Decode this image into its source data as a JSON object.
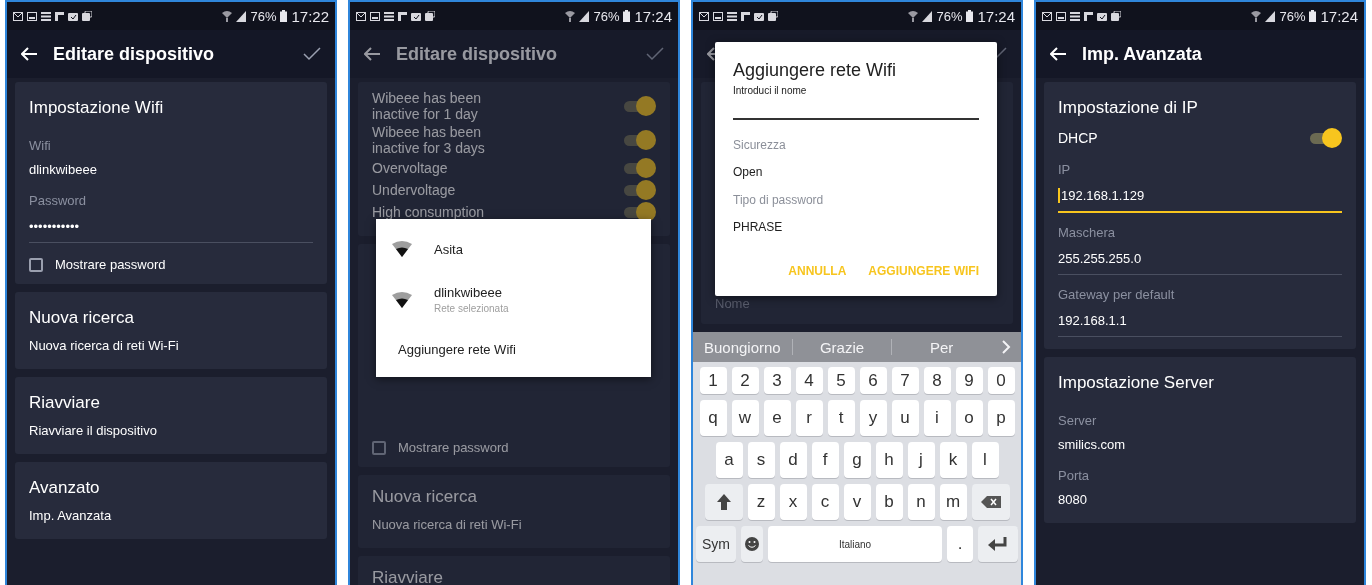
{
  "screens": [
    {
      "status_bar": {
        "battery": "76%",
        "time": "17:22"
      },
      "app_bar": {
        "title": "Editare dispositivo",
        "confirm": true
      },
      "cards": [
        {
          "title": "Impostazione Wifi",
          "rows": [
            {
              "kind": "field",
              "label": "Wifi",
              "value": "dlinkwibeee"
            },
            {
              "kind": "input",
              "label": "Password",
              "value": "•••••••••••",
              "focused": false
            },
            {
              "kind": "checkbox",
              "label": "Mostrare password",
              "checked": false
            }
          ]
        },
        {
          "title": "Nuova ricerca",
          "rows": [
            {
              "kind": "text",
              "text": "Nuova ricerca di reti Wi-Fi"
            }
          ]
        },
        {
          "title": "Riavviare",
          "rows": [
            {
              "kind": "text",
              "text": "Riavviare il dispositivo"
            }
          ]
        },
        {
          "title": "Avanzato",
          "rows": [
            {
              "kind": "text",
              "text": "Imp. Avanzata"
            }
          ]
        }
      ]
    },
    {
      "status_bar": {
        "battery": "76%",
        "time": "17:24"
      },
      "app_bar": {
        "title": "Editare dispositivo",
        "confirm": true
      },
      "cards": [
        {
          "rows": [
            {
              "kind": "toggle",
              "label": "Wibeee has been inactive for 1 day",
              "on": true
            },
            {
              "kind": "toggle",
              "label": "Wibeee has been inactive for 3 days",
              "on": true
            },
            {
              "kind": "toggle",
              "label": "Overvoltage",
              "on": true
            },
            {
              "kind": "toggle",
              "label": "Undervoltage",
              "on": true
            },
            {
              "kind": "toggle",
              "label": "High consumption",
              "on": true
            }
          ]
        },
        {
          "rows": [
            {
              "kind": "blank"
            },
            {
              "kind": "checkbox",
              "label": "Mostrare password",
              "checked": false
            }
          ]
        },
        {
          "title": "Nuova ricerca",
          "rows": [
            {
              "kind": "text",
              "text": "Nuova ricerca di reti Wi-Fi"
            }
          ]
        },
        {
          "title": "Riavviare"
        }
      ],
      "dialog": {
        "kind": "list",
        "networks": [
          {
            "name": "Asita"
          },
          {
            "name": "dlinkwibeee",
            "subtitle": "Rete selezionata"
          }
        ],
        "action": "Aggiungere rete Wifi"
      }
    },
    {
      "status_bar": {
        "battery": "76%",
        "time": "17:24"
      },
      "app_bar": {
        "confirm": true
      },
      "cards": [
        {
          "rows": [
            {
              "kind": "blank"
            },
            {
              "kind": "label",
              "text": "Nome"
            }
          ]
        }
      ],
      "dialog": {
        "kind": "form",
        "title": "Aggiungere rete Wifi",
        "name_field": {
          "label": "Introduci il nome"
        },
        "fields": [
          {
            "label": "Sicurezza",
            "value": "Open"
          },
          {
            "label": "Tipo di password",
            "value": "PHRASE"
          }
        ],
        "actions": [
          "ANNULLA",
          "AGGIUNGERE WIFI"
        ]
      },
      "keyboard": {
        "suggestions": [
          "Buongiorno",
          "Grazie",
          "Per"
        ],
        "rows": [
          {
            "keys": [
              "1",
              "2",
              "3",
              "4",
              "5",
              "6",
              "7",
              "8",
              "9",
              "0"
            ]
          },
          {
            "keys": [
              "q",
              "w",
              "e",
              "r",
              "t",
              "y",
              "u",
              "i",
              "o",
              "p"
            ]
          },
          {
            "keys": [
              "a",
              "s",
              "d",
              "f",
              "g",
              "h",
              "j",
              "k",
              "l"
            ]
          },
          {
            "keys": [
              {
                "kind": "shift"
              },
              "z",
              "x",
              "c",
              "v",
              "b",
              "n",
              "m",
              {
                "kind": "backspace"
              }
            ]
          },
          {
            "keys": [
              {
                "kind": "sym",
                "label": "Sym"
              },
              {
                "kind": "emoji"
              },
              {
                "kind": "space",
                "label": "Italiano"
              },
              {
                "kind": "char",
                "label": "."
              },
              {
                "kind": "enter"
              }
            ]
          }
        ]
      }
    },
    {
      "status_bar": {
        "battery": "76%",
        "time": "17:24"
      },
      "app_bar": {
        "title": "Imp. Avanzata",
        "confirm": false
      },
      "cards": [
        {
          "title": "Impostazione di IP",
          "rows": [
            {
              "kind": "toggle",
              "label": "DHCP",
              "on": true
            },
            {
              "kind": "input",
              "label": "IP",
              "value": "192.168.1.129",
              "focused": true
            },
            {
              "kind": "input",
              "label": "Maschera",
              "value": "255.255.255.0",
              "focused": false
            },
            {
              "kind": "input",
              "label": "Gateway per default",
              "value": "192.168.1.1",
              "focused": false
            }
          ]
        },
        {
          "title": "Impostazione Server",
          "rows": [
            {
              "kind": "field",
              "label": "Server",
              "value": "smilics.com"
            },
            {
              "kind": "field",
              "label": "Porta",
              "value": "8080"
            }
          ]
        }
      ]
    }
  ]
}
